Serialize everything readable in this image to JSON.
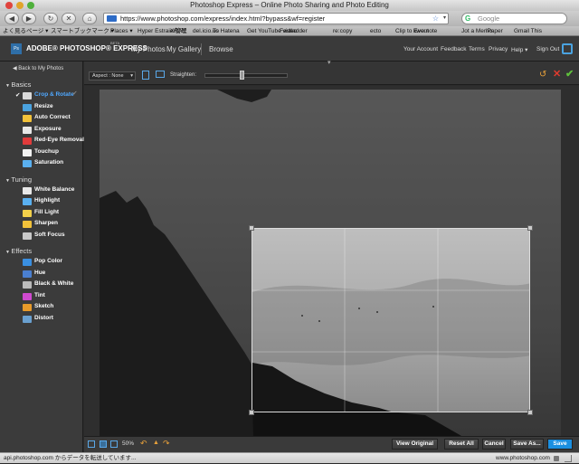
{
  "window": {
    "title": "Photoshop Express – Online Photo Sharing and Photo Editing"
  },
  "browser": {
    "url": "https://www.photoshop.com/express/index.html?bypass&wf=register",
    "search_placeholder": "Google",
    "bookmarks": [
      "よく見るページ ▾",
      "スマートブックマーク ▾",
      "Places ▾",
      "Hyper Estraier管理",
      "XRAY",
      "del.icio.us",
      "To Hatena",
      "Get YouTube video",
      "Fastladder",
      "re:copy",
      "ecto",
      "Clip to Evernote",
      "kwout",
      "Jot a Memo",
      "iPaper",
      "Gmail This"
    ]
  },
  "app": {
    "logo_text": "ADOBE® PHOTOSHOP® EXPRESS",
    "beta": "BETA",
    "logo_icon": "Ps",
    "nav": [
      "My Photos",
      "My Gallery",
      "Browse"
    ],
    "links": [
      "Your Account",
      "Feedback",
      "Terms",
      "Privacy",
      "Help ▾",
      "Sign Out"
    ]
  },
  "sidebar": {
    "back": "Back to My Photos",
    "sections": [
      {
        "name": "Basics",
        "tools": [
          "Crop & Rotate",
          "Resize",
          "Auto Correct",
          "Exposure",
          "Red-Eye Removal",
          "Touchup",
          "Saturation"
        ]
      },
      {
        "name": "Tuning",
        "tools": [
          "White Balance",
          "Highlight",
          "Fill Light",
          "Sharpen",
          "Soft Focus"
        ]
      },
      {
        "name": "Effects",
        "tools": [
          "Pop Color",
          "Hue",
          "Black & White",
          "Tint",
          "Sketch",
          "Distort"
        ]
      }
    ],
    "active_tool": "Crop & Rotate"
  },
  "editor": {
    "aspect": "Aspect : None",
    "straighten_label": "Straighten:",
    "straighten_value": 0.45
  },
  "bottom": {
    "zoom": "50%",
    "buttons": [
      "View Original",
      "Reset All",
      "Cancel",
      "Save As...",
      "Save"
    ]
  },
  "status": {
    "left": "api.photoshop.com からデータを転送しています...",
    "right": "www.photoshop.com"
  },
  "colors": {
    "accent": "#2b8fd6",
    "active_tool": "#4fa8ff",
    "save": "#1b8fe0"
  }
}
